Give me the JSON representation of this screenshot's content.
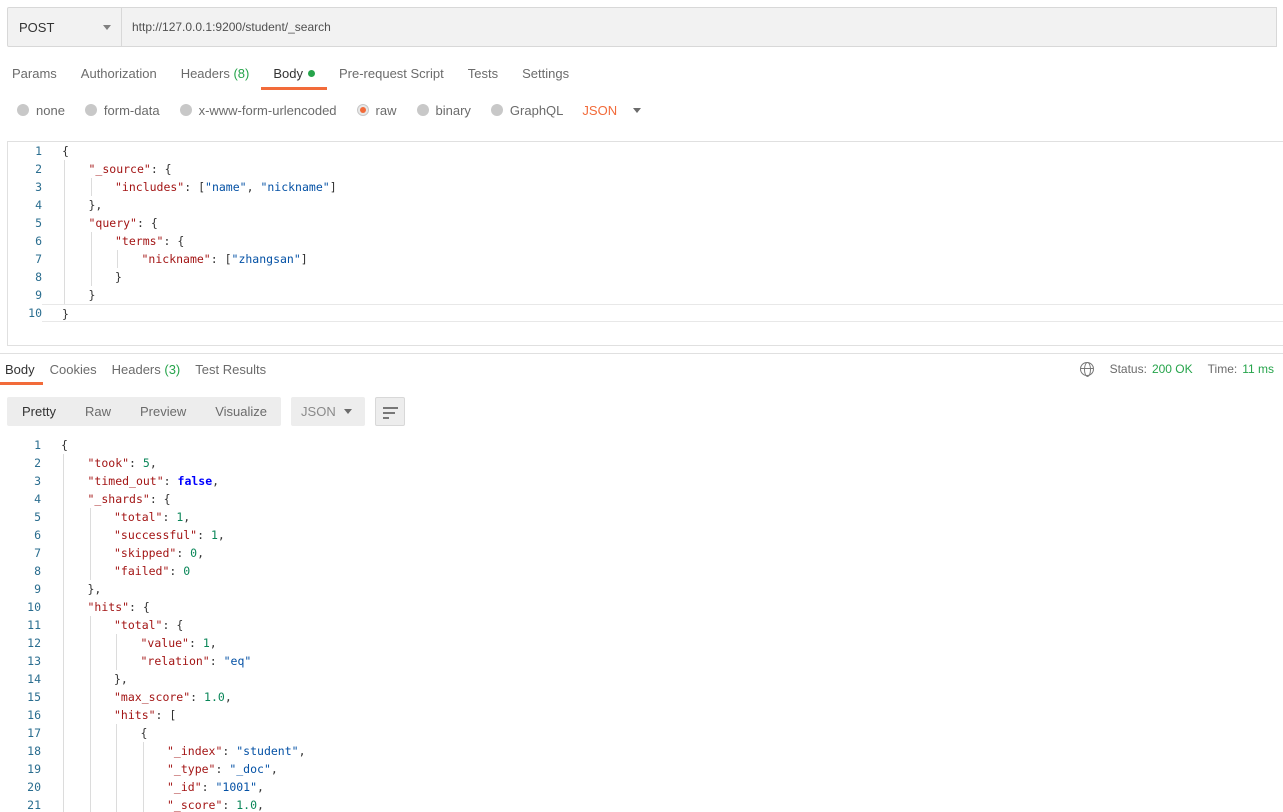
{
  "request": {
    "method": "POST",
    "url": "http://127.0.0.1:9200/student/_search"
  },
  "request_tabs": [
    {
      "label": "Params",
      "count": ""
    },
    {
      "label": "Authorization",
      "count": ""
    },
    {
      "label": "Headers",
      "count": "(8)"
    },
    {
      "label": "Body",
      "count": ""
    },
    {
      "label": "Pre-request Script",
      "count": ""
    },
    {
      "label": "Tests",
      "count": ""
    },
    {
      "label": "Settings",
      "count": ""
    }
  ],
  "body_types": [
    "none",
    "form-data",
    "x-www-form-urlencoded",
    "raw",
    "binary",
    "GraphQL"
  ],
  "body_format": "JSON",
  "request_body_lines": [
    [
      [
        "br",
        "{"
      ]
    ],
    [
      [
        "key",
        "\"_source\""
      ],
      [
        "br",
        ": {"
      ]
    ],
    [
      [
        "key",
        "\"includes\""
      ],
      [
        "br",
        ": ["
      ],
      [
        "str",
        "\"name\""
      ],
      [
        "br",
        ", "
      ],
      [
        "str",
        "\"nickname\""
      ],
      [
        "br",
        "]"
      ]
    ],
    [
      [
        "br",
        "},"
      ]
    ],
    [
      [
        "key",
        "\"query\""
      ],
      [
        "br",
        ": {"
      ]
    ],
    [
      [
        "key",
        "\"terms\""
      ],
      [
        "br",
        ": {"
      ]
    ],
    [
      [
        "key",
        "\"nickname\""
      ],
      [
        "br",
        ": ["
      ],
      [
        "str",
        "\"zhangsan\""
      ],
      [
        "br",
        "]"
      ]
    ],
    [
      [
        "br",
        "}"
      ]
    ],
    [
      [
        "br",
        "}"
      ]
    ],
    [
      [
        "br",
        "}"
      ]
    ]
  ],
  "response_tabs": [
    {
      "label": "Body",
      "count": ""
    },
    {
      "label": "Cookies",
      "count": ""
    },
    {
      "label": "Headers",
      "count": "(3)"
    },
    {
      "label": "Test Results",
      "count": ""
    }
  ],
  "status": {
    "status_label": "Status:",
    "status_value": "200 OK",
    "time_label": "Time:",
    "time_value": "11 ms"
  },
  "response_views": [
    "Pretty",
    "Raw",
    "Preview",
    "Visualize"
  ],
  "response_format": "JSON",
  "response_body_lines": [
    [
      [
        "br",
        "{"
      ]
    ],
    [
      [
        "key",
        "\"took\""
      ],
      [
        "br",
        ": "
      ],
      [
        "num",
        "5"
      ],
      [
        "br",
        ","
      ]
    ],
    [
      [
        "key",
        "\"timed_out\""
      ],
      [
        "br",
        ": "
      ],
      [
        "bool",
        "false"
      ],
      [
        "br",
        ","
      ]
    ],
    [
      [
        "key",
        "\"_shards\""
      ],
      [
        "br",
        ": {"
      ]
    ],
    [
      [
        "key",
        "\"total\""
      ],
      [
        "br",
        ": "
      ],
      [
        "num",
        "1"
      ],
      [
        "br",
        ","
      ]
    ],
    [
      [
        "key",
        "\"successful\""
      ],
      [
        "br",
        ": "
      ],
      [
        "num",
        "1"
      ],
      [
        "br",
        ","
      ]
    ],
    [
      [
        "key",
        "\"skipped\""
      ],
      [
        "br",
        ": "
      ],
      [
        "num",
        "0"
      ],
      [
        "br",
        ","
      ]
    ],
    [
      [
        "key",
        "\"failed\""
      ],
      [
        "br",
        ": "
      ],
      [
        "num",
        "0"
      ]
    ],
    [
      [
        "br",
        "},"
      ]
    ],
    [
      [
        "key",
        "\"hits\""
      ],
      [
        "br",
        ": {"
      ]
    ],
    [
      [
        "key",
        "\"total\""
      ],
      [
        "br",
        ": {"
      ]
    ],
    [
      [
        "key",
        "\"value\""
      ],
      [
        "br",
        ": "
      ],
      [
        "num",
        "1"
      ],
      [
        "br",
        ","
      ]
    ],
    [
      [
        "key",
        "\"relation\""
      ],
      [
        "br",
        ": "
      ],
      [
        "str",
        "\"eq\""
      ]
    ],
    [
      [
        "br",
        "},"
      ]
    ],
    [
      [
        "key",
        "\"max_score\""
      ],
      [
        "br",
        ": "
      ],
      [
        "num",
        "1.0"
      ],
      [
        "br",
        ","
      ]
    ],
    [
      [
        "key",
        "\"hits\""
      ],
      [
        "br",
        ": ["
      ]
    ],
    [
      [
        "br",
        "{"
      ]
    ],
    [
      [
        "key",
        "\"_index\""
      ],
      [
        "br",
        ": "
      ],
      [
        "str",
        "\"student\""
      ],
      [
        "br",
        ","
      ]
    ],
    [
      [
        "key",
        "\"_type\""
      ],
      [
        "br",
        ": "
      ],
      [
        "str",
        "\"_doc\""
      ],
      [
        "br",
        ","
      ]
    ],
    [
      [
        "key",
        "\"_id\""
      ],
      [
        "br",
        ": "
      ],
      [
        "str",
        "\"1001\""
      ],
      [
        "br",
        ","
      ]
    ],
    [
      [
        "key",
        "\"_score\""
      ],
      [
        "br",
        ": "
      ],
      [
        "num",
        "1.0"
      ],
      [
        "br",
        ","
      ]
    ]
  ]
}
